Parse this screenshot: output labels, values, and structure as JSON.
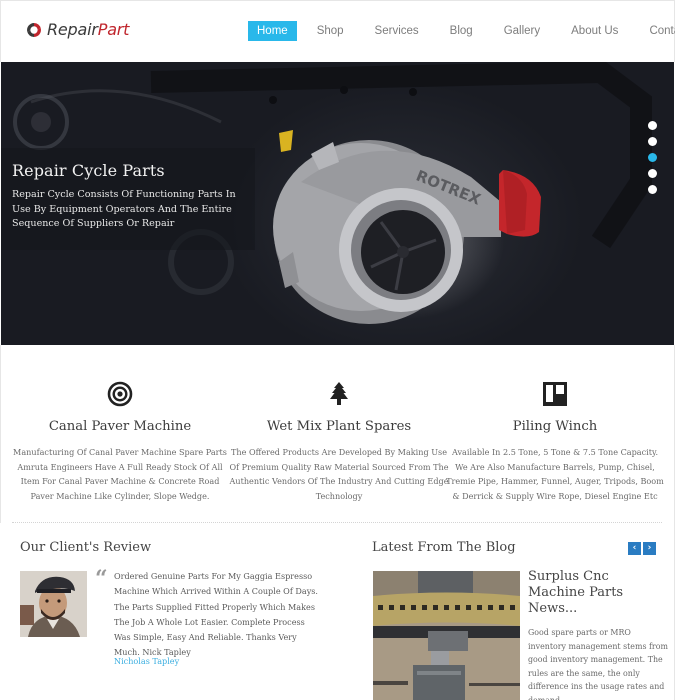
{
  "brand": {
    "name_part1": "Repair",
    "name_part2": "Part",
    "primary_color": "#c0262d",
    "accent_color": "#29b8ea"
  },
  "nav": {
    "items": [
      {
        "label": "Home",
        "active": true
      },
      {
        "label": "Shop",
        "active": false
      },
      {
        "label": "Services",
        "active": false
      },
      {
        "label": "Blog",
        "active": false
      },
      {
        "label": "Gallery",
        "active": false
      },
      {
        "label": "About Us",
        "active": false
      },
      {
        "label": "Contact Us",
        "active": false
      }
    ]
  },
  "hero": {
    "title": "Repair Cycle Parts",
    "text": "Repair Cycle Consists Of Functioning Parts In Use By Equipment Operators And The Entire Sequence Of Suppliers Or Repair",
    "image_subject": "turbocharger",
    "image_label": "ROTREX",
    "slides_total": 5,
    "active_slide": 3
  },
  "features": [
    {
      "icon": "target-icon",
      "title": "Canal Paver Machine",
      "description": "Manufacturing Of Canal Paver Machine Spare Parts Amruta Engineers Have A Full Ready Stock Of All Item For Canal Paver Machine & Concrete Road Paver Machine Like Cylinder, Slope Wedge."
    },
    {
      "icon": "tree-icon",
      "title": "Wet Mix Plant Spares",
      "description": "The Offered Products Are Developed By Making Use Of Premium Quality Raw Material Sourced From The Authentic Vendors Of The Industry And Cutting Edge Technology"
    },
    {
      "icon": "board-icon",
      "title": "Piling Winch",
      "description": "Available In 2.5 Tone, 5 Tone & 7.5 Tone Capacity. We Are Also Manufacture Barrels, Pump, Chisel, Tremie Pipe, Hammer, Funnel, Auger, Tripods, Boom & Derrick & Supply Wire Rope, Diesel Engine Etc"
    }
  ],
  "review": {
    "heading": "Our Client's Review",
    "quote_mark": "“",
    "text": "Ordered Genuine Parts For My Gaggia Espresso Machine Which Arrived Within A Couple Of Days. The Parts Supplied Fitted Properly Which Makes The Job A Whole Lot Easier. Complete Process Was Simple, Easy And Reliable. Thanks Very Much. Nick Tapley",
    "author": "Nicholas Tapley"
  },
  "blog": {
    "heading": "Latest From The Blog",
    "prev_label": "‹",
    "next_label": "›",
    "post": {
      "title": "Surplus Cnc Machine Parts News...",
      "excerpt": "Good spare parts or MRO inventory management stems from good inventory management. The rules are the same, the only difference ins the usage rates and demand"
    }
  }
}
